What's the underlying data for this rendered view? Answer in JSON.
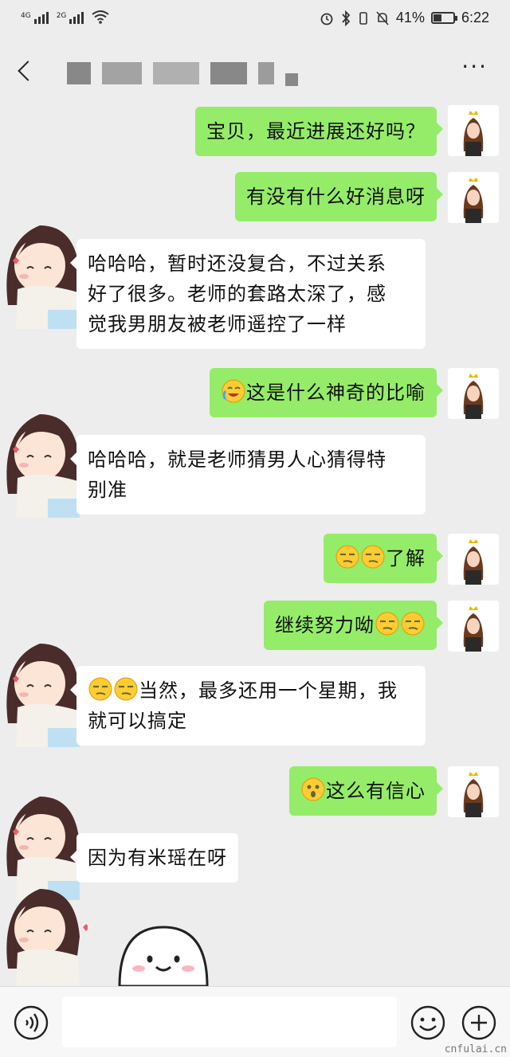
{
  "status_bar": {
    "net1": "4G",
    "net2": "2G",
    "battery": "41%",
    "time": "6:22"
  },
  "header": {
    "back_icon": "chevron-left-icon",
    "more_label": "···"
  },
  "messages": [
    {
      "side": "me",
      "text": "宝贝，最近进展还好吗？"
    },
    {
      "side": "me",
      "text": "有没有什么好消息呀"
    },
    {
      "side": "them",
      "line1": "哈哈哈，暂时还没复合，不过关系",
      "line2": "好了很多。老师的套路太深了，感",
      "line3": "觉我男朋友被老师遥控了一样"
    },
    {
      "side": "me",
      "text": "这是什么神奇的比喻",
      "emoji": "crying-laugh-emoji"
    },
    {
      "side": "them",
      "line1": "哈哈哈，就是老师猜男人心猜得特",
      "line2": "别准"
    },
    {
      "side": "me",
      "text": "了解",
      "emoji": "smug-emoji"
    },
    {
      "side": "me",
      "text": "继续努力呦",
      "emoji": "smug-emoji"
    },
    {
      "side": "them",
      "line1": "当然，最多还用一个星期，我",
      "line2": "就可以搞定",
      "emoji": "smug-emoji"
    },
    {
      "side": "me",
      "text": "这么有信心",
      "emoji": "surprised-emoji"
    },
    {
      "side": "them",
      "text": "因为有米瑶在呀"
    }
  ],
  "input": {
    "placeholder": "",
    "voice_icon": "voice-icon",
    "emoji_icon": "smiley-icon",
    "plus_icon": "plus-icon"
  },
  "watermark": "cnfulai.cn"
}
